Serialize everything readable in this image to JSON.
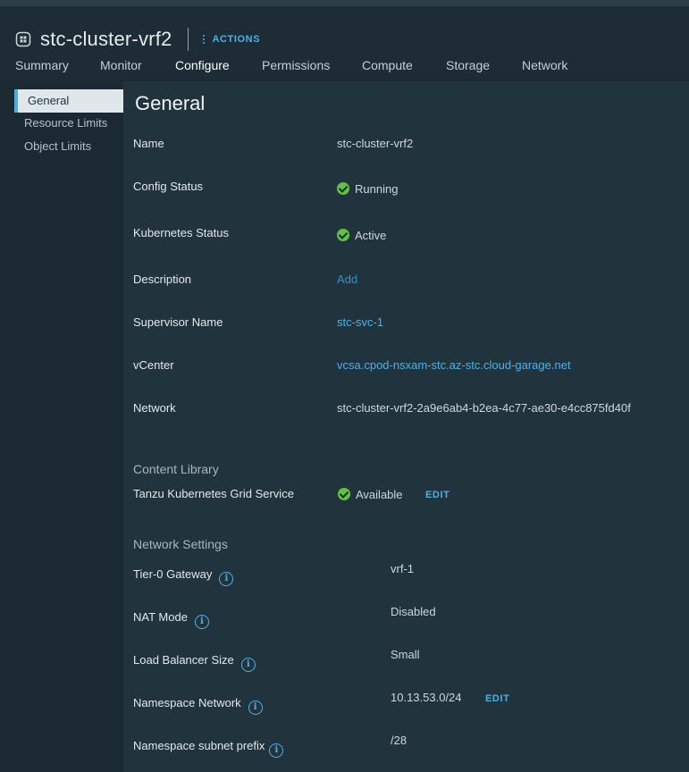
{
  "header": {
    "title": "stc-cluster-vrf2",
    "title_icon": "namespace-icon",
    "actions_label": "ACTIONS"
  },
  "tabs": [
    {
      "label": "Summary"
    },
    {
      "label": "Monitor"
    },
    {
      "label": "Configure",
      "active": true
    },
    {
      "label": "Permissions"
    },
    {
      "label": "Compute"
    },
    {
      "label": "Storage"
    },
    {
      "label": "Network"
    }
  ],
  "sidebar": {
    "items": [
      {
        "label": "General",
        "active": true
      },
      {
        "label": "Resource Limits"
      },
      {
        "label": "Object Limits"
      }
    ]
  },
  "main": {
    "heading": "General",
    "name": {
      "label": "Name",
      "value": "stc-cluster-vrf2"
    },
    "config_status": {
      "label": "Config Status",
      "value": "Running"
    },
    "k8s_status": {
      "label": "Kubernetes Status",
      "value": "Active"
    },
    "description": {
      "label": "Description",
      "value": "Add"
    },
    "supervisor": {
      "label": "Supervisor Name",
      "value": "stc-svc-1"
    },
    "vcenter": {
      "label": "vCenter",
      "value": "vcsa.cpod-nsxam-stc.az-stc.cloud-garage.net"
    },
    "network": {
      "label": "Network",
      "value": "stc-cluster-vrf2-2a9e6ab4-b2ea-4c77-ae30-e4cc875fd40f"
    },
    "content_library": {
      "section": "Content Library",
      "label": "Tanzu Kubernetes Grid Service",
      "value": "Available",
      "edit": "EDIT"
    },
    "network_settings": {
      "section": "Network Settings",
      "tier0": {
        "label": "Tier-0 Gateway",
        "value": "vrf-1"
      },
      "nat": {
        "label": "NAT Mode",
        "value": "Disabled"
      },
      "lb": {
        "label": "Load Balancer Size",
        "value": "Small"
      },
      "ns_network": {
        "label": "Namespace Network",
        "value": "10.13.53.0/24",
        "edit": "EDIT"
      },
      "subnet_prefix": {
        "label": "Namespace subnet prefix",
        "value": "/28"
      }
    }
  },
  "colors": {
    "accent": "#49afd9",
    "link": "#4fb0e6",
    "status_ok": "#61c440",
    "background": "#21333d"
  }
}
